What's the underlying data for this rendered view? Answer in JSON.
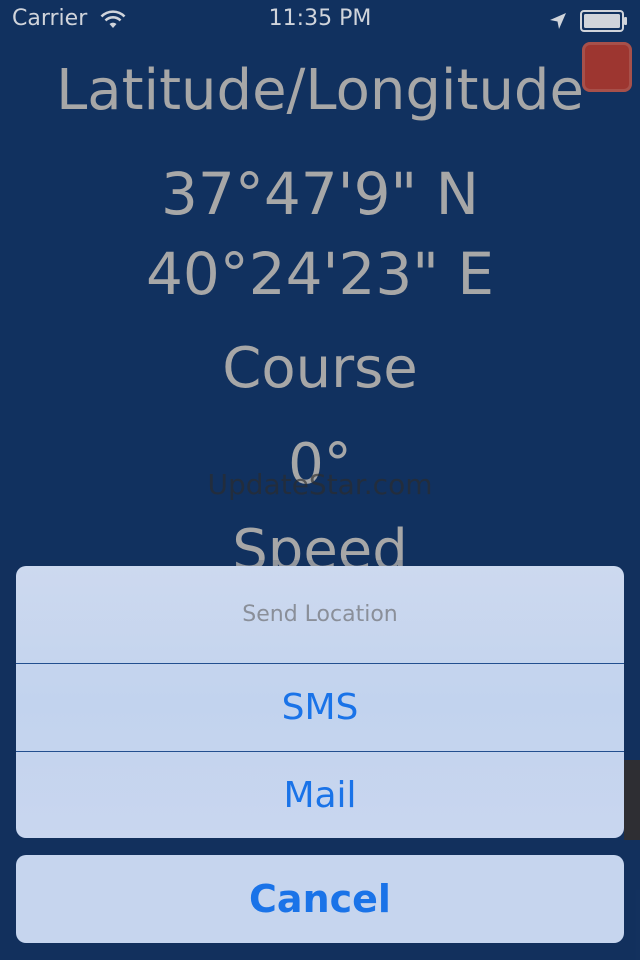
{
  "status_bar": {
    "carrier": "Carrier",
    "time": "11:35 PM",
    "icons": [
      "wifi-icon",
      "location-arrow-icon",
      "battery-icon"
    ]
  },
  "main": {
    "title": "Latitude/Longitude",
    "latitude": "37°47'9\" N",
    "longitude": "40°24'23\" E",
    "course_label": "Course",
    "course_value": "0°",
    "speed_label": "Speed",
    "watermark": "UpdateStar.com"
  },
  "action_sheet": {
    "title": "Send Location",
    "options": [
      "SMS",
      "Mail"
    ],
    "cancel": "Cancel"
  },
  "colors": {
    "background": "#11315f",
    "text": "#a7a7a7",
    "accent": "#1a73e8",
    "record_button": "#9d3630"
  }
}
